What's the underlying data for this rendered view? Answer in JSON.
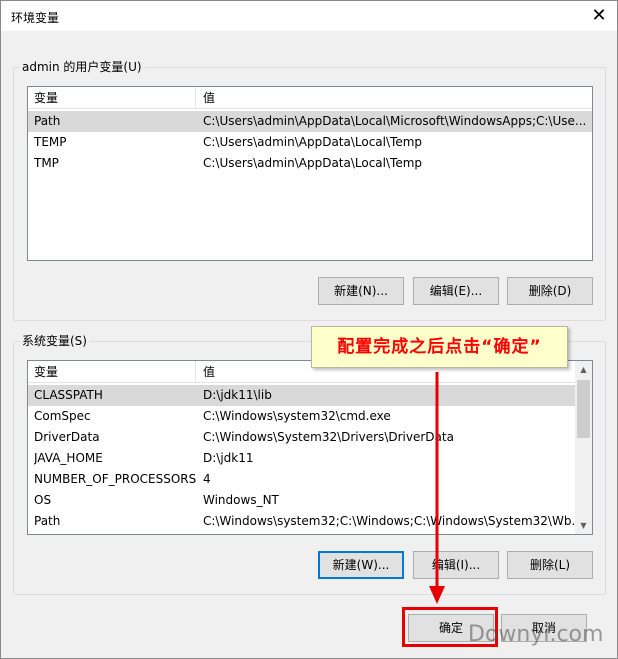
{
  "window": {
    "title": "环境变量"
  },
  "user_vars": {
    "label": "admin 的用户变量(U)",
    "columns": [
      "变量",
      "值"
    ],
    "rows": [
      {
        "name": "Path",
        "value": "C:\\Users\\admin\\AppData\\Local\\Microsoft\\WindowsApps;C:\\Use..."
      },
      {
        "name": "TEMP",
        "value": "C:\\Users\\admin\\AppData\\Local\\Temp"
      },
      {
        "name": "TMP",
        "value": "C:\\Users\\admin\\AppData\\Local\\Temp"
      }
    ],
    "buttons": {
      "new": "新建(N)...",
      "edit": "编辑(E)...",
      "delete": "删除(D)"
    }
  },
  "system_vars": {
    "label": "系统变量(S)",
    "columns": [
      "变量",
      "值"
    ],
    "rows": [
      {
        "name": "CLASSPATH",
        "value": "D:\\jdk11\\lib"
      },
      {
        "name": "ComSpec",
        "value": "C:\\Windows\\system32\\cmd.exe"
      },
      {
        "name": "DriverData",
        "value": "C:\\Windows\\System32\\Drivers\\DriverData"
      },
      {
        "name": "JAVA_HOME",
        "value": "D:\\jdk11"
      },
      {
        "name": "NUMBER_OF_PROCESSORS",
        "value": "4"
      },
      {
        "name": "OS",
        "value": "Windows_NT"
      },
      {
        "name": "Path",
        "value": "C:\\Windows\\system32;C:\\Windows;C:\\Windows\\System32\\Wb..."
      }
    ],
    "buttons": {
      "new": "新建(W)...",
      "edit": "编辑(I)...",
      "delete": "删除(L)"
    }
  },
  "footer": {
    "ok": "确定",
    "cancel": "取消"
  },
  "annotation": {
    "callout_text": "配置完成之后点击“确定”",
    "color": "#e60000"
  },
  "watermark": "Downyi.com"
}
